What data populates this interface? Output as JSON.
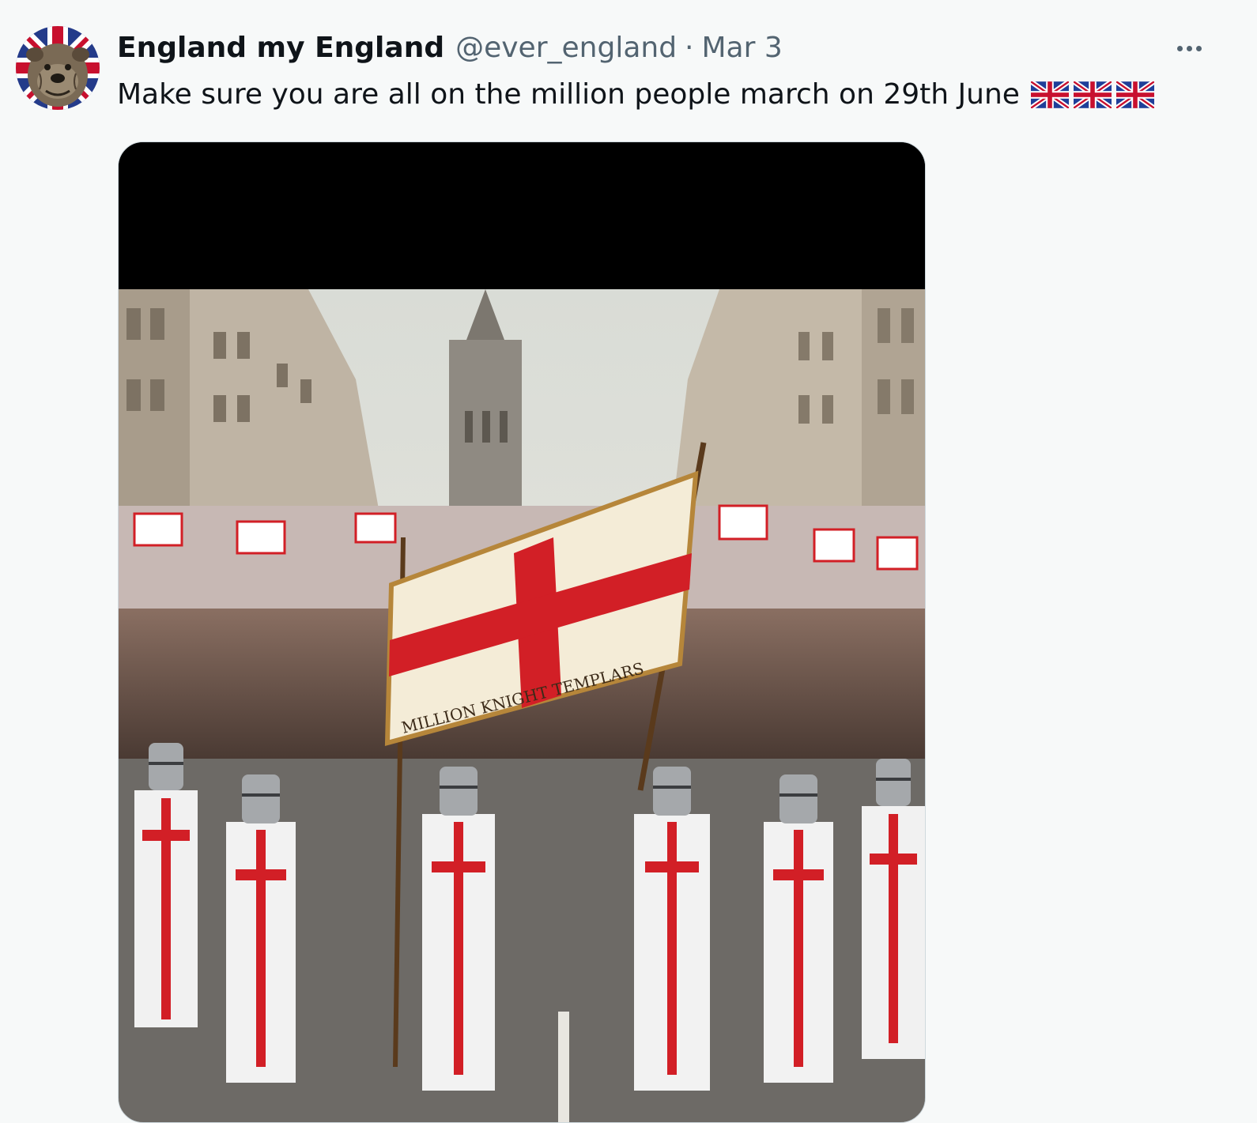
{
  "tweet": {
    "author": {
      "display_name": "England my England",
      "handle": "@ever_england",
      "avatar_icon": "bulldog-union-jack-avatar"
    },
    "separator": "·",
    "date": "Mar 3",
    "text": "Make sure you are all on the million people march on 29th June",
    "flag_emoji_count": 3,
    "flag_icon": "union-jack-flag-icon",
    "more_icon": "more-options-icon",
    "media": {
      "type": "image",
      "banner_text": "MILLION KNIGHT TEMPLARS"
    }
  },
  "colors": {
    "background": "#f7f9f9",
    "text_primary": "#0f1419",
    "text_secondary": "#536471",
    "border": "#cfd9de",
    "st_george_red": "#d21f26"
  }
}
